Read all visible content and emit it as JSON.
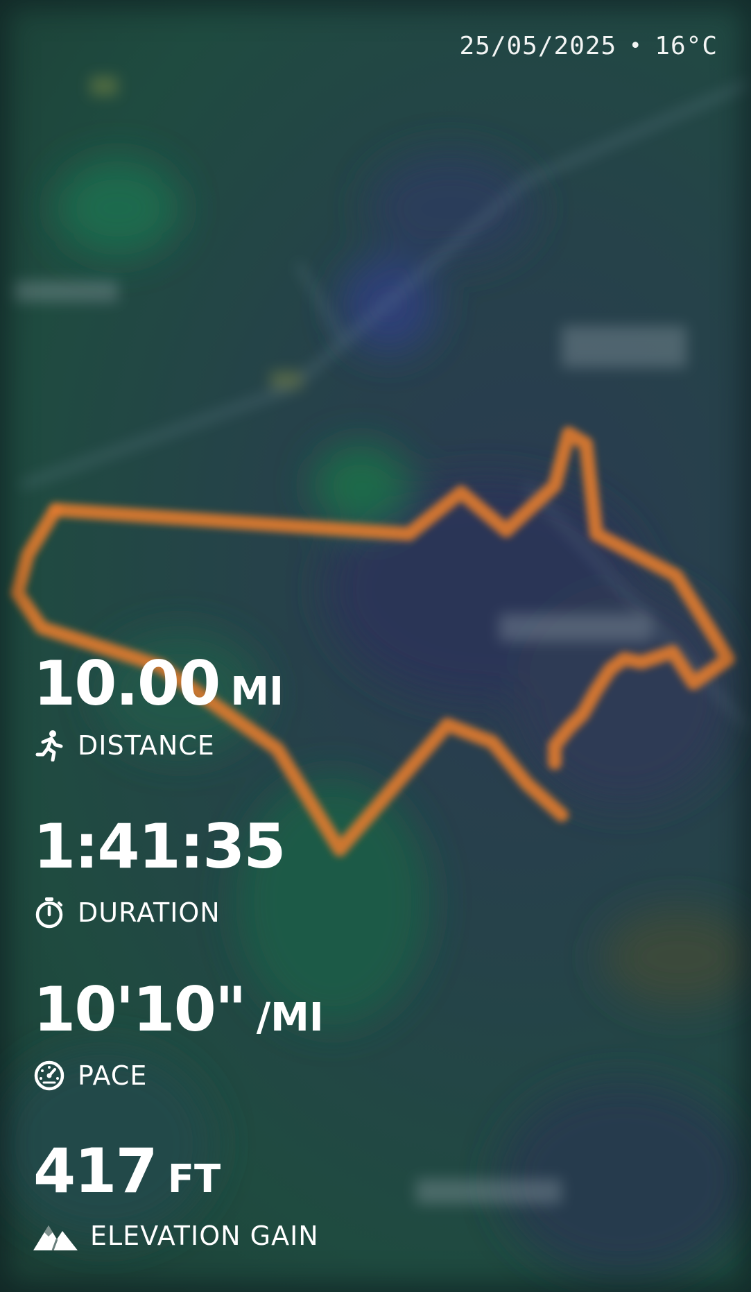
{
  "header": {
    "date": "25/05/2025",
    "separator": "•",
    "temperature": "16°C"
  },
  "stats": {
    "distance": {
      "value": "10.00",
      "unit": "MI",
      "label": "DISTANCE",
      "icon": "runner-icon"
    },
    "duration": {
      "value": "1:41:35",
      "label": "DURATION",
      "icon": "stopwatch-icon"
    },
    "pace": {
      "value": "10'10\"",
      "unit": "/MI",
      "label": "PACE",
      "icon": "speedometer-icon"
    },
    "elevation": {
      "value": "417",
      "unit": "FT",
      "label": "ELEVATION GAIN",
      "icon": "mountain-icon"
    }
  },
  "colors": {
    "route": "#e07a2e",
    "text": "#ffffff",
    "map_base": "#22453f"
  }
}
